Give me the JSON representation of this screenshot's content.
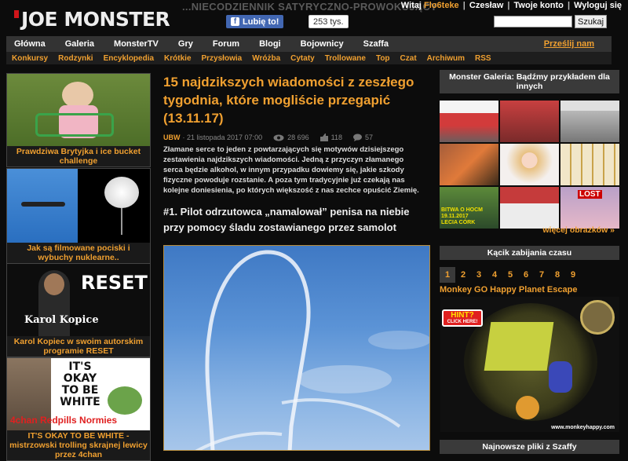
{
  "header": {
    "logo_text": "JOE MONSTER",
    "tagline": "...NIECODZIENNIK SATYRYCZNO-PROWOKUJĄCY",
    "fb_like": "Lubię to!",
    "fb_count": "253 tys.",
    "greeting": "Witaj",
    "user": "Flo6teke",
    "links": [
      "Czesław",
      "Twoje konto",
      "Wyloguj się"
    ],
    "search_button": "Szukaj",
    "search_value": ""
  },
  "nav_main": [
    "Główna",
    "Galeria",
    "MonsterTV",
    "Gry",
    "Forum",
    "Blogi",
    "Bojownicy",
    "Szaffa"
  ],
  "nav_send": "Prześlij nam",
  "nav_sub": [
    "Konkursy",
    "Rodzynki",
    "Encyklopedia",
    "Krótkie",
    "Przysłowia",
    "Wróżba",
    "Cytaty",
    "Trollowane",
    "Top",
    "Czat",
    "Archiwum",
    "RSS"
  ],
  "left_tiles": [
    {
      "caption": "Prawdziwa Brytyjka i ice bucket challenge"
    },
    {
      "caption": "Jak są filmowane pociski i wybuchy nuklearne.."
    },
    {
      "caption": "Karol Kopiec w swoim autorskim programie RESET",
      "img_text_big": "RESET",
      "img_text_small": "Karol Kopice"
    },
    {
      "caption": "IT'S OKAY TO BE WHITE - mistrzowski trolling skrajnej lewicy przez 4chan",
      "img_text_big": "IT'S OKAY TO BE WHITE",
      "img_text_small": "4chan Redpills Normies"
    }
  ],
  "article": {
    "title": "15 najdzikszych wiadomości z zeszłego tygodnia, które mogliście przegapić (13.11.17)",
    "author": "UBW",
    "date": "· 21 listopada 2017 07:00",
    "views": "28 696",
    "likes": "118",
    "comments": "57",
    "lead": "Złamane serce to jeden z powtarzających się motywów dzisiejszego zestawienia najdzikszych wiadomości. Jedną z przyczyn złamanego serca będzie alkohol, w innym przypadku dowiemy się, jakie szkody fizyczne powoduje rozstanie. A poza tym tradycyjnie już czekają nas kolejne doniesienia, po których większość z nas zechce opuścić Ziemię.",
    "subheading": "#1. Pilot odrzutowca „namalował” penisa na niebie przy pomocy śladu zostawianego przez samolot"
  },
  "right": {
    "gallery_header": "Monster Galeria: Bądźmy przykładem dla innych",
    "gallery_img_texts": [
      "BITWA O HOCM",
      "LECIA CÓRK",
      "19.11.2017",
      "LOST"
    ],
    "more_link": "więcej obrazków »",
    "kill_time_header": "Kącik zabijania czasu",
    "pages": [
      "1",
      "2",
      "3",
      "4",
      "5",
      "6",
      "7",
      "8",
      "9"
    ],
    "game_title": "Monkey GO Happy Planet Escape",
    "game_hint": "HINT?",
    "game_hint_sub": "CLICK HERE!",
    "game_url": "www.monkeyhappy.com",
    "files_header": "Najnowsze pliki z Szaffy"
  },
  "colors": {
    "accent": "#f0a030",
    "logo_red": "#d0151a",
    "bg": "#0c0c0c",
    "bar": "#333333"
  }
}
